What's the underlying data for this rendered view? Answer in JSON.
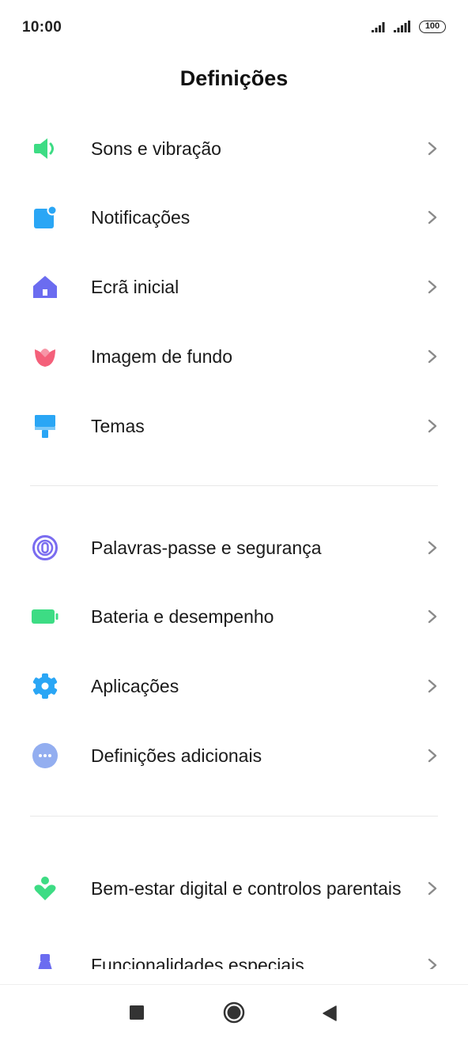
{
  "status": {
    "time": "10:00",
    "battery": "100"
  },
  "header": {
    "title": "Definições"
  },
  "items": [
    {
      "label": "Sons e vibração",
      "icon": "speaker-icon",
      "color": "#3ddc84"
    },
    {
      "label": "Notificações",
      "icon": "notification-icon",
      "color": "#2aa6f5"
    },
    {
      "label": "Ecrã inicial",
      "icon": "home-icon",
      "color": "#6b6cf0"
    },
    {
      "label": "Imagem de fundo",
      "icon": "tulip-icon",
      "color": "#f4607a"
    },
    {
      "label": "Temas",
      "icon": "paint-brush-icon",
      "color": "#2aa6f5"
    },
    {
      "label": "Palavras-passe e segurança",
      "icon": "fingerprint-icon",
      "color": "#7a6cf0"
    },
    {
      "label": "Bateria e desempenho",
      "icon": "battery-icon",
      "color": "#3ddc84"
    },
    {
      "label": "Aplicações",
      "icon": "gear-icon",
      "color": "#2aa6f5"
    },
    {
      "label": "Definições adicionais",
      "icon": "more-icon",
      "color": "#93aef0"
    },
    {
      "label": "Bem-estar digital e controlos parentais",
      "icon": "wellbeing-icon",
      "color": "#3ddc84"
    },
    {
      "label": "Funcionalidades especiais",
      "icon": "special-features-icon",
      "color": "#6b6cf0"
    }
  ],
  "nav": {
    "recents": "recents-icon",
    "home": "home-button-icon",
    "back": "back-icon"
  }
}
